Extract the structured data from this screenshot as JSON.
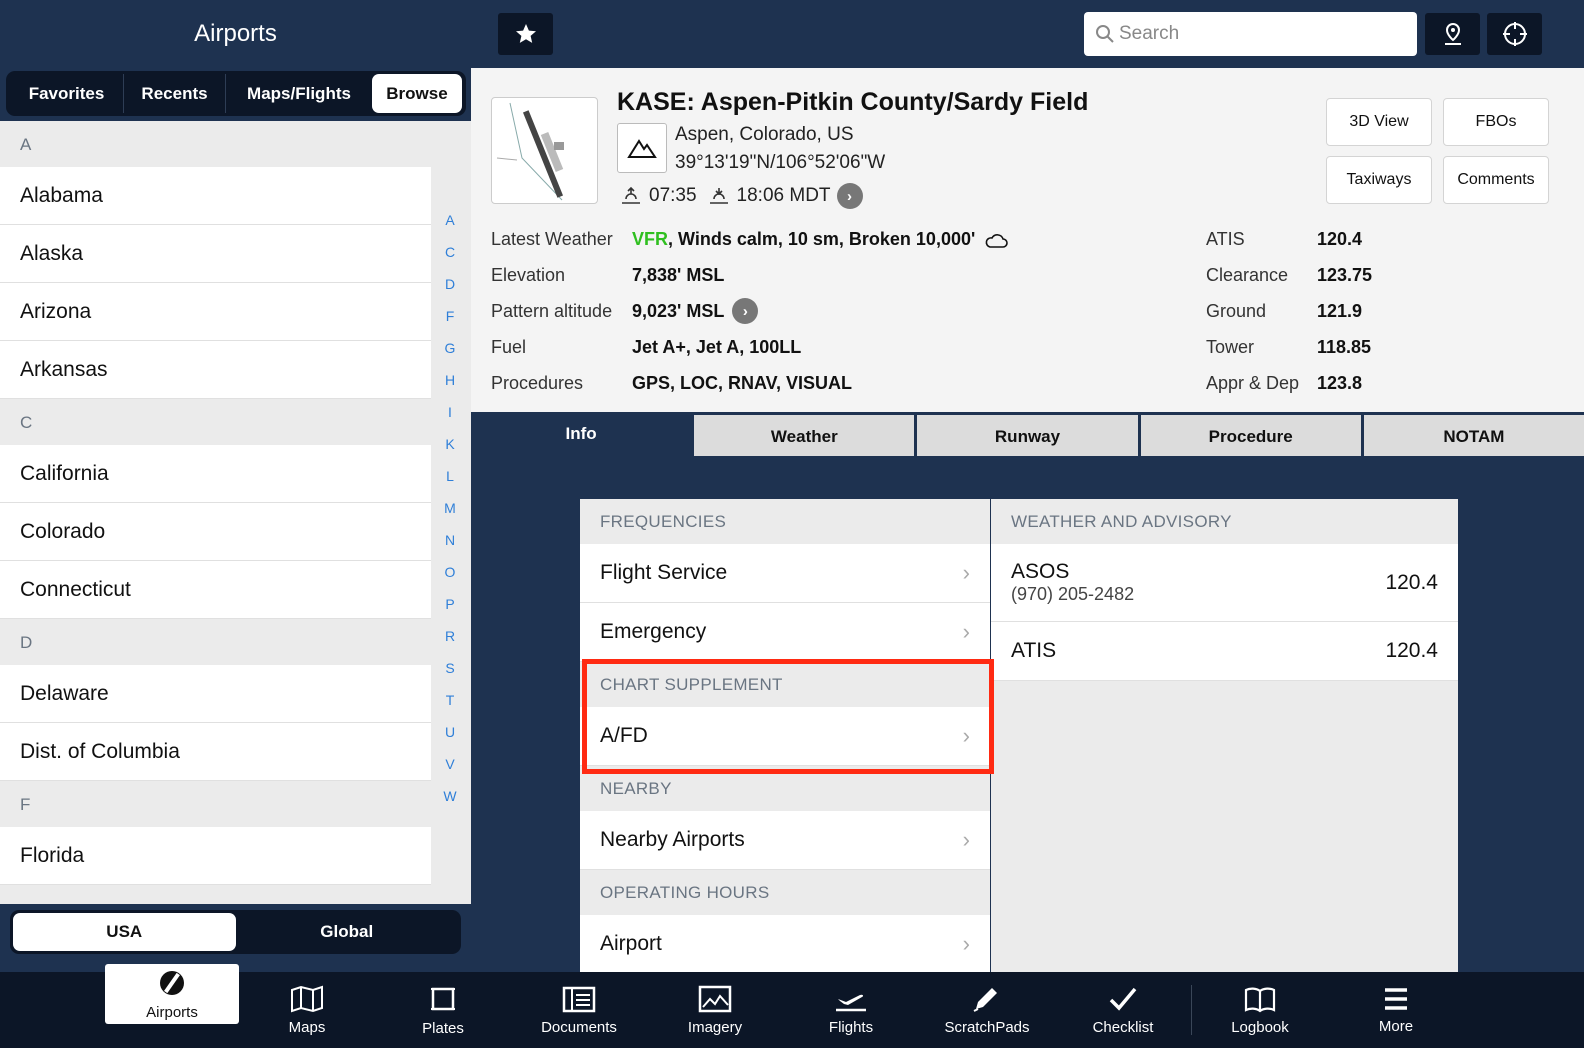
{
  "sidebar": {
    "title": "Airports",
    "tabs": [
      "Favorites",
      "Recents",
      "Maps/Flights",
      "Browse"
    ],
    "active_tab": "Browse",
    "sections": [
      {
        "letter": "A",
        "items": [
          "Alabama",
          "Alaska",
          "Arizona",
          "Arkansas"
        ]
      },
      {
        "letter": "C",
        "items": [
          "California",
          "Colorado",
          "Connecticut"
        ]
      },
      {
        "letter": "D",
        "items": [
          "Delaware",
          "Dist. of Columbia"
        ]
      },
      {
        "letter": "F",
        "items": [
          "Florida"
        ]
      }
    ],
    "index": [
      "A",
      "C",
      "D",
      "F",
      "G",
      "H",
      "I",
      "K",
      "L",
      "M",
      "N",
      "O",
      "P",
      "R",
      "S",
      "T",
      "U",
      "V",
      "W"
    ],
    "region": {
      "options": [
        "USA",
        "Global"
      ],
      "active": "USA"
    }
  },
  "topbar": {
    "search_placeholder": "Search"
  },
  "airport": {
    "title": "KASE: Aspen-Pitkin County/Sardy Field",
    "location": "Aspen, Colorado, US",
    "coordinates": "39°13'19\"N/106°52'06\"W",
    "sunrise": "07:35",
    "sunset": "18:06 MDT",
    "buttons": [
      "3D View",
      "FBOs",
      "Taxiways",
      "Comments"
    ],
    "info": [
      {
        "label": "Latest Weather",
        "value_flight_rules": "VFR",
        "value": ", Winds calm, 10 sm, Broken 10,000'"
      },
      {
        "label": "Elevation",
        "value": "7,838' MSL"
      },
      {
        "label": "Pattern altitude",
        "value": "9,023' MSL"
      },
      {
        "label": "Fuel",
        "value": "Jet A+, Jet A, 100LL"
      },
      {
        "label": "Procedures",
        "value": "GPS, LOC, RNAV, VISUAL"
      }
    ],
    "frequencies": [
      {
        "label": "ATIS",
        "value": "120.4"
      },
      {
        "label": "Clearance",
        "value": "123.75"
      },
      {
        "label": "Ground",
        "value": "121.9"
      },
      {
        "label": "Tower",
        "value": "118.85"
      },
      {
        "label": "Appr & Dep",
        "value": "123.8"
      }
    ],
    "vfr_color": "#2fbf1f"
  },
  "tabs": [
    "Info",
    "Weather",
    "Runway",
    "Procedure",
    "NOTAM"
  ],
  "active_tab": "Info",
  "info_panel": {
    "frequencies_header": "FREQUENCIES",
    "frequencies": [
      "Flight Service",
      "Emergency"
    ],
    "chart_supplement_header": "CHART SUPPLEMENT",
    "chart_supplement": [
      "A/FD"
    ],
    "nearby_header": "NEARBY",
    "nearby": [
      "Nearby Airports"
    ],
    "operating_hours_header": "OPERATING HOURS",
    "operating_hours": [
      "Airport"
    ]
  },
  "weather_panel": {
    "header": "WEATHER AND ADVISORY",
    "items": [
      {
        "name": "ASOS",
        "sub": "(970) 205-2482",
        "freq": "120.4"
      },
      {
        "name": "ATIS",
        "sub": "",
        "freq": "120.4"
      }
    ]
  },
  "highlight_color": "#ff2a12",
  "bottom_nav": [
    {
      "label": "Airports",
      "icon": "airports-icon"
    },
    {
      "label": "Maps",
      "icon": "maps-icon"
    },
    {
      "label": "Plates",
      "icon": "plates-icon"
    },
    {
      "label": "Documents",
      "icon": "documents-icon"
    },
    {
      "label": "Imagery",
      "icon": "imagery-icon"
    },
    {
      "label": "Flights",
      "icon": "flights-icon"
    },
    {
      "label": "ScratchPads",
      "icon": "scratchpads-icon"
    },
    {
      "label": "Checklist",
      "icon": "checklist-icon"
    },
    {
      "label": "Logbook",
      "icon": "logbook-icon"
    },
    {
      "label": "More",
      "icon": "more-icon"
    }
  ]
}
